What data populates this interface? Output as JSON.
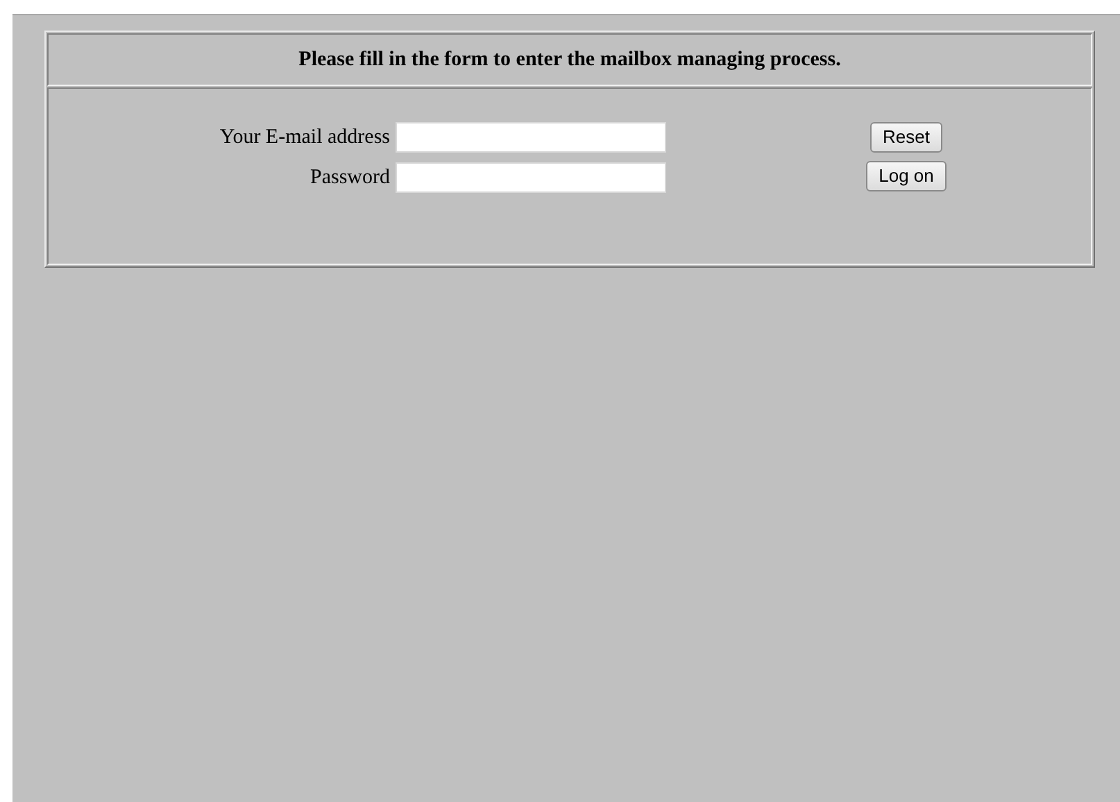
{
  "form": {
    "heading": "Please fill in the form to enter the mailbox managing process.",
    "fields": [
      {
        "label": "Your E-mail address"
      },
      {
        "label": "Password"
      }
    ],
    "buttons": [
      "Reset",
      "Log on"
    ]
  }
}
